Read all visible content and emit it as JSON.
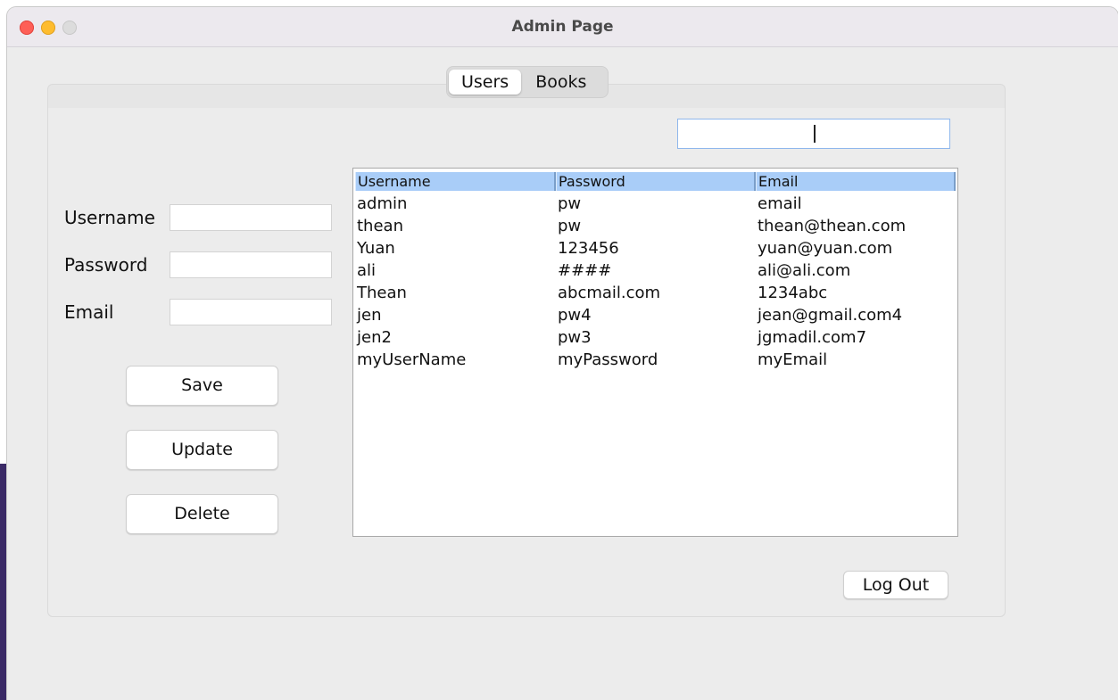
{
  "window": {
    "title": "Admin Page"
  },
  "tabs": [
    {
      "label": "Users",
      "active": true
    },
    {
      "label": "Books",
      "active": false
    }
  ],
  "search": {
    "value": ""
  },
  "form": {
    "username_label": "Username",
    "password_label": "Password",
    "email_label": "Email",
    "username_value": "",
    "password_value": "",
    "email_value": ""
  },
  "buttons": {
    "save": "Save",
    "update": "Update",
    "delete": "Delete",
    "logout": "Log Out"
  },
  "table": {
    "columns": [
      "Username",
      "Password",
      "Email"
    ],
    "rows": [
      [
        "admin",
        "pw",
        "email"
      ],
      [
        "thean",
        "pw",
        "thean@thean.com"
      ],
      [
        "Yuan",
        "123456",
        "yuan@yuan.com"
      ],
      [
        "ali",
        "####",
        "ali@ali.com"
      ],
      [
        "Thean",
        "abcmail.com",
        "1234abc"
      ],
      [
        "jen",
        "pw4",
        "jean@gmail.com4"
      ],
      [
        "jen2",
        "pw3",
        "jgmadil.com7"
      ],
      [
        "myUserName",
        "myPassword",
        "myEmail"
      ]
    ]
  },
  "colors": {
    "header_bg": "#a9cdf8",
    "close": "#fe5f57",
    "minimize": "#febc2e"
  }
}
